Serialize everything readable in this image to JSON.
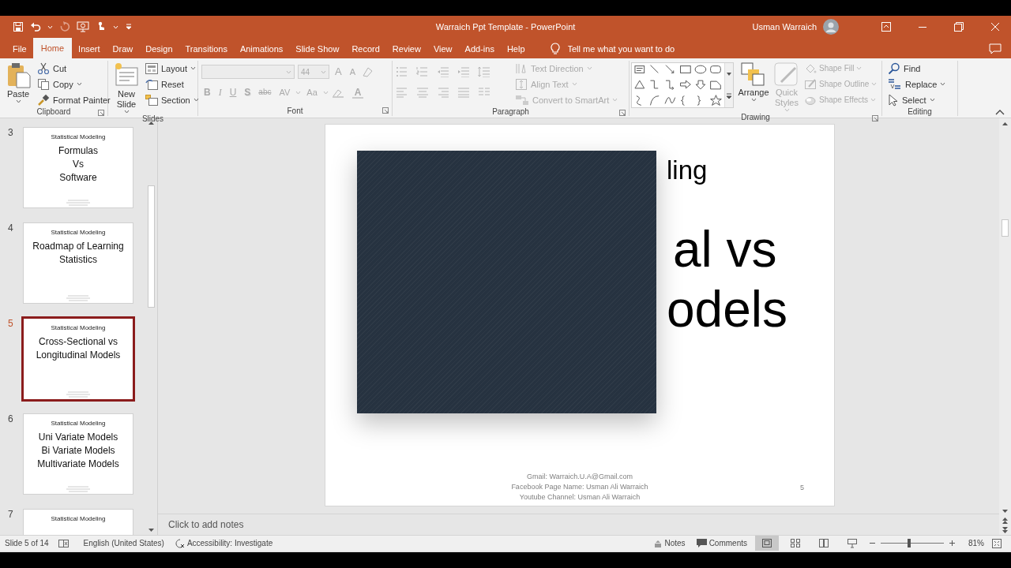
{
  "window": {
    "title": "Warraich Ppt Template  -  PowerPoint",
    "user": "Usman Warraich"
  },
  "tabs": [
    {
      "label": "File",
      "selected": false
    },
    {
      "label": "Home",
      "selected": true
    },
    {
      "label": "Insert",
      "selected": false
    },
    {
      "label": "Draw",
      "selected": false
    },
    {
      "label": "Design",
      "selected": false
    },
    {
      "label": "Transitions",
      "selected": false
    },
    {
      "label": "Animations",
      "selected": false
    },
    {
      "label": "Slide Show",
      "selected": false
    },
    {
      "label": "Record",
      "selected": false
    },
    {
      "label": "Review",
      "selected": false
    },
    {
      "label": "View",
      "selected": false
    },
    {
      "label": "Add-ins",
      "selected": false
    },
    {
      "label": "Help",
      "selected": false
    }
  ],
  "tell_me": {
    "placeholder": "Tell me what you want to do"
  },
  "ribbon": [
    {
      "kind": "clipboard",
      "label": "Clipboard",
      "large": [
        {
          "label": "Paste",
          "dropdown": true,
          "disabled": false
        }
      ],
      "small": [
        {
          "label": "Cut",
          "dropdown": false,
          "disabled": false
        },
        {
          "label": "Copy",
          "dropdown": true,
          "disabled": false
        },
        {
          "label": "Format Painter",
          "dropdown": false,
          "disabled": false
        }
      ]
    },
    {
      "kind": "slides",
      "label": "Slides",
      "large": [
        {
          "label": "New Slide",
          "dropdown": true,
          "disabled": false
        }
      ],
      "small": [
        {
          "label": "Layout",
          "dropdown": true,
          "disabled": false
        },
        {
          "label": "Reset",
          "dropdown": false,
          "disabled": false
        },
        {
          "label": "Section",
          "dropdown": true,
          "disabled": false
        }
      ]
    },
    {
      "kind": "font",
      "label": "Font",
      "font_size": {
        "value": "44",
        "disabled": true
      },
      "size_buttons": [
        {
          "label": "A",
          "kind": "grow",
          "disabled": true
        },
        {
          "label": "A",
          "kind": "shrink",
          "disabled": true
        }
      ],
      "buttons": [
        {
          "label": "B",
          "kind": "bold",
          "disabled": true
        },
        {
          "label": "I",
          "kind": "italic",
          "disabled": true
        },
        {
          "label": "U",
          "kind": "underline",
          "disabled": true
        },
        {
          "label": "S",
          "kind": "shadow",
          "disabled": true
        },
        {
          "label": "abc",
          "kind": "strike",
          "disabled": true
        },
        {
          "label": "AV",
          "kind": "spacing",
          "disabled": true
        },
        {
          "label": "Aa",
          "kind": "case",
          "disabled": true
        },
        {
          "label": "A",
          "kind": "color",
          "disabled": true
        }
      ]
    },
    {
      "kind": "paragraph",
      "label": "Paragraph",
      "small": [
        {
          "label": "Text Direction",
          "dropdown": true,
          "disabled": true
        },
        {
          "label": "Align Text",
          "dropdown": true,
          "disabled": true
        },
        {
          "label": "Convert to SmartArt",
          "dropdown": true,
          "disabled": true
        }
      ]
    },
    {
      "kind": "drawing",
      "label": "Drawing",
      "large": [
        {
          "label": "Arrange",
          "dropdown": true,
          "disabled": false
        },
        {
          "label": "Quick Styles",
          "dropdown": true,
          "disabled": true
        }
      ],
      "small": [
        {
          "label": "Shape Fill",
          "dropdown": true,
          "disabled": true
        },
        {
          "label": "Shape Outline",
          "dropdown": true,
          "disabled": true
        },
        {
          "label": "Shape Effects",
          "dropdown": true,
          "disabled": true
        }
      ]
    },
    {
      "kind": "editing",
      "label": "Editing",
      "small": [
        {
          "label": "Find",
          "dropdown": false,
          "disabled": false
        },
        {
          "label": "Replace",
          "dropdown": true,
          "disabled": false
        },
        {
          "label": "Select",
          "dropdown": true,
          "disabled": false
        }
      ]
    }
  ],
  "thumbnails": [
    {
      "number": "3",
      "header": "Statistical Modeling",
      "lines": [
        "Formulas",
        "Vs",
        "Software"
      ],
      "selected": false
    },
    {
      "number": "4",
      "header": "Statistical Modeling",
      "lines": [
        "Roadmap of Learning",
        "Statistics"
      ],
      "selected": false
    },
    {
      "number": "5",
      "header": "Statistical Modeling",
      "lines": [
        "Cross-Sectional vs",
        "Longitudinal Models"
      ],
      "selected": true
    },
    {
      "number": "6",
      "header": "Statistical Modeling",
      "lines": [
        "Uni Variate Models",
        "Bi Variate Models",
        "Multivariate Models"
      ],
      "selected": false
    },
    {
      "number": "7",
      "header": "Statistical Modeling",
      "selected": false
    }
  ],
  "slide": {
    "title_fragments": [
      "ling",
      "al vs",
      "odels"
    ],
    "footer": [
      "Gmail: Warraich.U.A@Gmail.com",
      "Facebook Page Name: Usman Ali Warraich",
      "Youtube Channel: Usman Ali Warraich"
    ],
    "page_number": "5"
  },
  "notes": {
    "placeholder": "Click to add notes"
  },
  "status_bar": {
    "slide_info": "Slide 5 of 14",
    "language": "English (United States)",
    "accessibility": "Accessibility: Investigate",
    "notes": "Notes",
    "comments": "Comments",
    "views": [
      {
        "kind": "normal",
        "selected": true
      },
      {
        "kind": "sorter",
        "selected": false
      },
      {
        "kind": "reading",
        "selected": false
      },
      {
        "kind": "slideshow",
        "selected": false
      }
    ],
    "zoom": {
      "level": 0.45,
      "reading": "81%"
    }
  }
}
